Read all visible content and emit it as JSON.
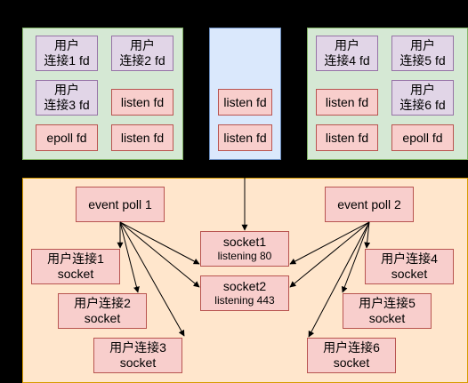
{
  "process1": {
    "conn1": {
      "line1": "用户",
      "line2": "连接1 fd"
    },
    "conn2": {
      "line1": "用户",
      "line2": "连接2 fd"
    },
    "conn3": {
      "line1": "用户",
      "line2": "连接3 fd"
    },
    "listen_a": "listen fd",
    "listen_b": "listen fd",
    "epoll": "epoll fd"
  },
  "kernel_fds": {
    "listen_a": "listen fd",
    "listen_b": "listen fd"
  },
  "process2": {
    "conn4": {
      "line1": "用户",
      "line2": "连接4 fd"
    },
    "conn5": {
      "line1": "用户",
      "line2": "连接5 fd"
    },
    "conn6": {
      "line1": "用户",
      "line2": "连接6 fd"
    },
    "listen_a": "listen fd",
    "listen_b": "listen fd",
    "epoll": "epoll fd"
  },
  "kernel": {
    "event_poll_1": "event poll 1",
    "event_poll_2": "event poll 2",
    "socket1": {
      "name": "socket1",
      "sub": "listening 80"
    },
    "socket2": {
      "name": "socket2",
      "sub": "listening 443"
    },
    "user_sockets": [
      {
        "name": "用户连接1",
        "sub": "socket"
      },
      {
        "name": "用户连接2",
        "sub": "socket"
      },
      {
        "name": "用户连接3",
        "sub": "socket"
      },
      {
        "name": "用户连接4",
        "sub": "socket"
      },
      {
        "name": "用户连接5",
        "sub": "socket"
      },
      {
        "name": "用户连接6",
        "sub": "socket"
      }
    ]
  },
  "colors": {
    "background": "#000000",
    "process_panel": "#d5e8d4",
    "fd_panel": "#dae8fc",
    "kernel_panel": "#ffe6cc",
    "conn_fd": "#e1d5e7",
    "object": "#f8cecc"
  }
}
